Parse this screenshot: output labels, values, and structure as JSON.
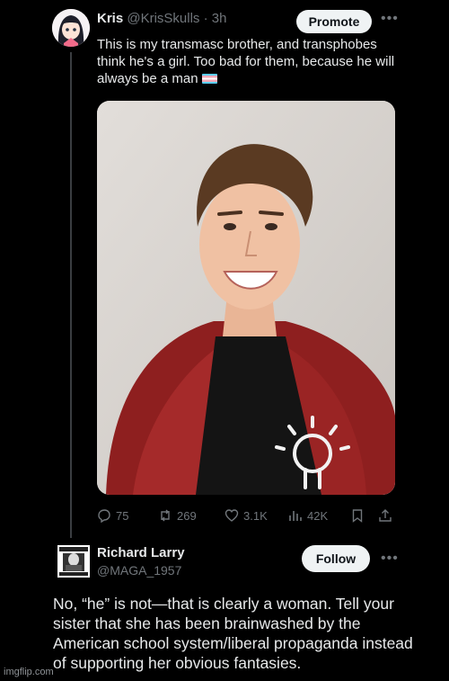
{
  "post": {
    "author_name": "Kris",
    "author_handle": "@KrisSkulls",
    "separator": "·",
    "time": "3h",
    "promote_label": "Promote",
    "more_icon": "more-horizontal-icon",
    "text": "This is my transmasc brother, and transphobes think he's a girl. Too bad for them, because he will always be a man",
    "flag_icon": "transgender-flag-icon",
    "image_alt": "Photo of a smiling man in a red leather jacket and black t-shirt with a light bulb graphic",
    "stats": {
      "replies": "75",
      "reposts": "269",
      "likes": "3.1K",
      "views": "42K"
    }
  },
  "reply": {
    "author_name": "Richard Larry",
    "author_handle": "@MAGA_1957",
    "follow_label": "Follow",
    "text": "No, “he” is not—that is clearly a woman. Tell your sister that she has been brainwashed by the American school system/liberal propaganda instead of supporting her obvious fantasies."
  },
  "watermark": "imgflip.com",
  "colors": {
    "background": "#000000",
    "text_primary": "#e7e9ea",
    "text_secondary": "#71767b",
    "button_bg": "#eff3f4"
  }
}
